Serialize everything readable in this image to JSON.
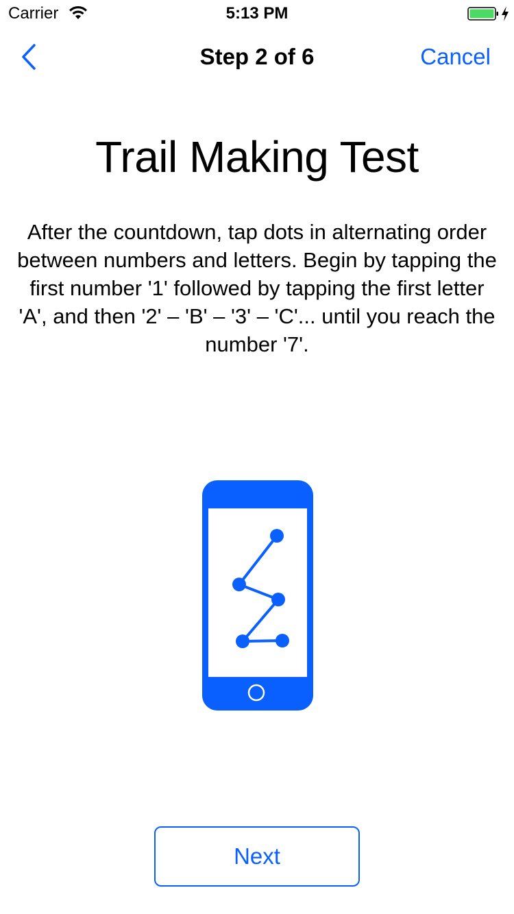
{
  "status_bar": {
    "carrier": "Carrier",
    "time": "5:13 PM",
    "icons": {
      "wifi": "wifi-icon",
      "battery": "battery-icon",
      "charging": "charging-icon"
    },
    "battery_color": "#4cd964"
  },
  "nav": {
    "back_icon": "chevron-left-icon",
    "title": "Step 2 of 6",
    "cancel_label": "Cancel"
  },
  "content": {
    "title": "Trail Making Test",
    "instructions": "After the countdown, tap dots in alternating order between numbers and letters. Begin by tapping the first number '1' followed by tapping the first letter 'A', and then '2' – 'B' – '3' – 'C'... until you reach the number '7'.",
    "illustration_icon": "phone-trail-icon"
  },
  "footer": {
    "next_label": "Next"
  },
  "colors": {
    "accent": "#0a60ff",
    "background": "#ffffff",
    "text": "#000000"
  }
}
